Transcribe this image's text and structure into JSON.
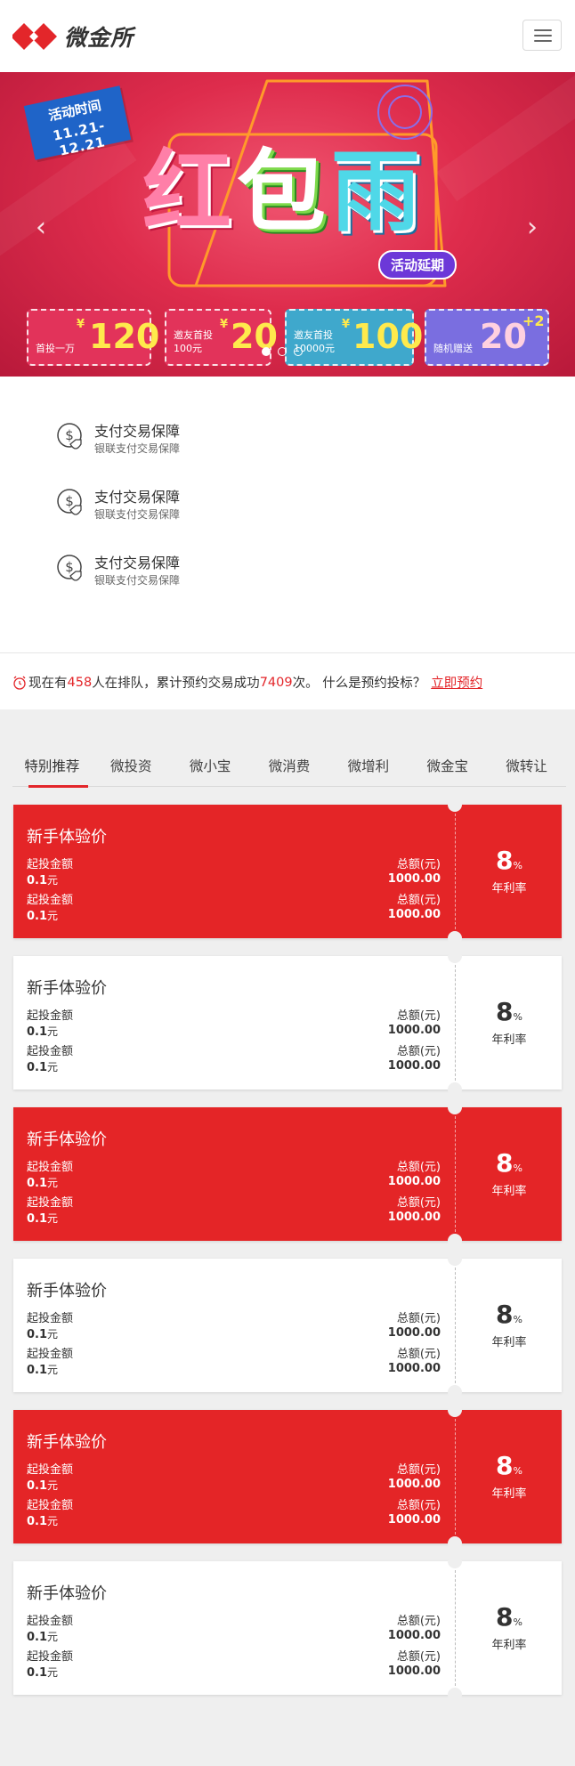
{
  "header": {
    "logo_text": "微金所",
    "menu_icon": "hamburger-menu-icon"
  },
  "banner": {
    "date_title": "活动时间",
    "date_range": "11.21-12.21",
    "headline": [
      "红",
      "包",
      "雨"
    ],
    "extended_label": "活动延期",
    "tickets": [
      {
        "caption": "首投一万",
        "amount": "120",
        "prefix": "¥"
      },
      {
        "caption": "邀友首投 100元",
        "amount": "20",
        "prefix": "¥"
      },
      {
        "caption": "邀友首投 10000元",
        "amount": "100",
        "prefix": "¥"
      },
      {
        "caption": "随机赠送",
        "amount": "20",
        "suffix": "+2"
      }
    ],
    "colors": {
      "bg": "#de2c4c",
      "date_tag": "#1f64c8",
      "ticket_amount": "#ffea4c",
      "extended": "#6c38d8"
    }
  },
  "guarantees": [
    {
      "title": "支付交易保障",
      "subtitle": "银联支付交易保障"
    },
    {
      "title": "支付交易保障",
      "subtitle": "银联支付交易保障"
    },
    {
      "title": "支付交易保障",
      "subtitle": "银联支付交易保障"
    }
  ],
  "notice": {
    "t1": "现在有",
    "queue_count": "458",
    "t2": "人在排队，累计预约交易成功",
    "success_count": "7409",
    "t3": "次。 什么是预约投标？",
    "link": "立即预约"
  },
  "tabs": [
    "特别推荐",
    "微投资",
    "微小宝",
    "微消费",
    "微增利",
    "微金宝",
    "微转让"
  ],
  "active_tab": 0,
  "products": [
    {
      "style": "red",
      "title": "新手体验价",
      "min_label": "起投金额",
      "min_value": "0.1",
      "min_unit": "元",
      "total_label": "总额(元)",
      "total_value": "1000.00",
      "rate": "8",
      "rate_unit": "%",
      "rate_label": "年利率"
    },
    {
      "style": "white",
      "title": "新手体验价",
      "min_label": "起投金额",
      "min_value": "0.1",
      "min_unit": "元",
      "total_label": "总额(元)",
      "total_value": "1000.00",
      "rate": "8",
      "rate_unit": "%",
      "rate_label": "年利率"
    },
    {
      "style": "red",
      "title": "新手体验价",
      "min_label": "起投金额",
      "min_value": "0.1",
      "min_unit": "元",
      "total_label": "总额(元)",
      "total_value": "1000.00",
      "rate": "8",
      "rate_unit": "%",
      "rate_label": "年利率"
    },
    {
      "style": "white",
      "title": "新手体验价",
      "min_label": "起投金额",
      "min_value": "0.1",
      "min_unit": "元",
      "total_label": "总额(元)",
      "total_value": "1000.00",
      "rate": "8",
      "rate_unit": "%",
      "rate_label": "年利率"
    },
    {
      "style": "red",
      "title": "新手体验价",
      "min_label": "起投金额",
      "min_value": "0.1",
      "min_unit": "元",
      "total_label": "总额(元)",
      "total_value": "1000.00",
      "rate": "8",
      "rate_unit": "%",
      "rate_label": "年利率"
    },
    {
      "style": "white",
      "title": "新手体验价",
      "min_label": "起投金额",
      "min_value": "0.1",
      "min_unit": "元",
      "total_label": "总额(元)",
      "total_value": "1000.00",
      "rate": "8",
      "rate_unit": "%",
      "rate_label": "年利率"
    }
  ],
  "colors": {
    "accent_red": "#e42527",
    "page_bg": "#efefef"
  }
}
